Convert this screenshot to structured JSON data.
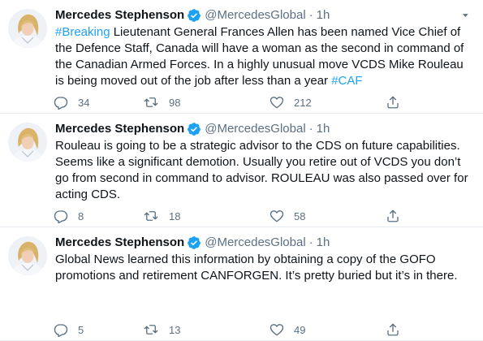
{
  "colors": {
    "accent": "#1da1f2",
    "text": "#0f1419",
    "muted": "#5b7083",
    "divider": "#e6ecf0"
  },
  "icons": {
    "verified": "verified-badge-icon",
    "more": "more-icon",
    "reply": "reply-icon",
    "retweet": "retweet-icon",
    "like": "heart-icon",
    "share": "share-icon"
  },
  "tweets": [
    {
      "author": {
        "name": "Mercedes Stephenson",
        "handle": "@MercedesGlobal"
      },
      "dot": "·",
      "time": "1h",
      "text": {
        "hashtag1": "#Breaking",
        "body": " Lieutenant General Frances Allen has been named Vice Chief of the Defence Staff, Canada will have a woman as the second in command of the Canadian Armed Forces. In a highly unusual move VCDS Mike Rouleau is being moved out of the job after less than a year ",
        "hashtag2": "#CAF"
      },
      "stats": {
        "replies": "34",
        "retweets": "98",
        "likes": "212"
      }
    },
    {
      "author": {
        "name": "Mercedes Stephenson",
        "handle": "@MercedesGlobal"
      },
      "dot": "·",
      "time": "1h",
      "text": {
        "body": "Rouleau is going to be a strategic advisor to the CDS on future capabilities. Seems like a significant demotion. Usually you retire out of VCDS you don’t go from second in command to advisor. ROULEAU was also passed over for acting CDS."
      },
      "stats": {
        "replies": "8",
        "retweets": "18",
        "likes": "58"
      }
    },
    {
      "author": {
        "name": "Mercedes Stephenson",
        "handle": "@MercedesGlobal"
      },
      "dot": "·",
      "time": "1h",
      "text": {
        "body": "Global News learned this information by obtaining a copy of the GOFO promotions and retirement CANFORGEN. It’s pretty buried but it’s in there."
      },
      "stats": {
        "replies": "5",
        "retweets": "13",
        "likes": "49"
      }
    }
  ]
}
